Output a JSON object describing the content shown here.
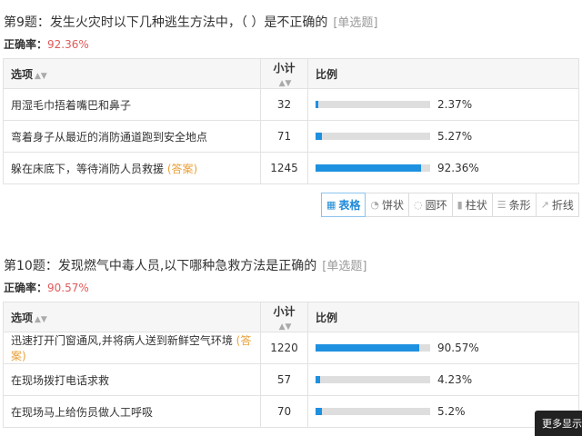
{
  "questions": [
    {
      "title": "第9题：发生火灾时以下几种逃生方法中，（ ）是不正确的",
      "type": "[单选题]",
      "rate_label": "正确率：",
      "rate_value": "92.36%",
      "headers": {
        "option": "选项",
        "count": "小计",
        "percent": "比例"
      },
      "rows": [
        {
          "option": "用湿毛巾捂着嘴巴和鼻子",
          "answer": "",
          "count": "32",
          "percent": "2.37%",
          "fraction": 0.0237
        },
        {
          "option": "弯着身子从最近的消防通道跑到安全地点",
          "answer": "",
          "count": "71",
          "percent": "5.27%",
          "fraction": 0.0527
        },
        {
          "option": "躲在床底下，等待消防人员救援",
          "answer": "(答案)",
          "count": "1245",
          "percent": "92.36%",
          "fraction": 0.9236
        }
      ]
    },
    {
      "title": "第10题：发现燃气中毒人员,以下哪种急救方法是正确的",
      "type": "[单选题]",
      "rate_label": "正确率：",
      "rate_value": "90.57%",
      "headers": {
        "option": "选项",
        "count": "小计",
        "percent": "比例"
      },
      "rows": [
        {
          "option": "迅速打开门窗通风,并将病人送到新鲜空气环境",
          "answer": "(答案)",
          "count": "1220",
          "percent": "90.57%",
          "fraction": 0.9057
        },
        {
          "option": "在现场拨打电话求救",
          "answer": "",
          "count": "57",
          "percent": "4.23%",
          "fraction": 0.0423
        },
        {
          "option": "在现场马上给伤员做人工呼吸",
          "answer": "",
          "count": "70",
          "percent": "5.2%",
          "fraction": 0.052
        }
      ]
    }
  ],
  "toolbar": [
    {
      "label": "表格",
      "icon": "table-icon",
      "active": true
    },
    {
      "label": "饼状",
      "icon": "pie-icon",
      "active": false
    },
    {
      "label": "圆环",
      "icon": "donut-icon",
      "active": false
    },
    {
      "label": "柱状",
      "icon": "bar-chart-icon",
      "active": false
    },
    {
      "label": "条形",
      "icon": "horizontal-bar-icon",
      "active": false
    },
    {
      "label": "折线",
      "icon": "line-chart-icon",
      "active": false
    }
  ],
  "more_tip": "更多显示",
  "colors": {
    "bar_fill": "#1e90e0",
    "bar_track": "#dedede",
    "rate": "#e05a5a",
    "answer": "#e9a13a"
  }
}
